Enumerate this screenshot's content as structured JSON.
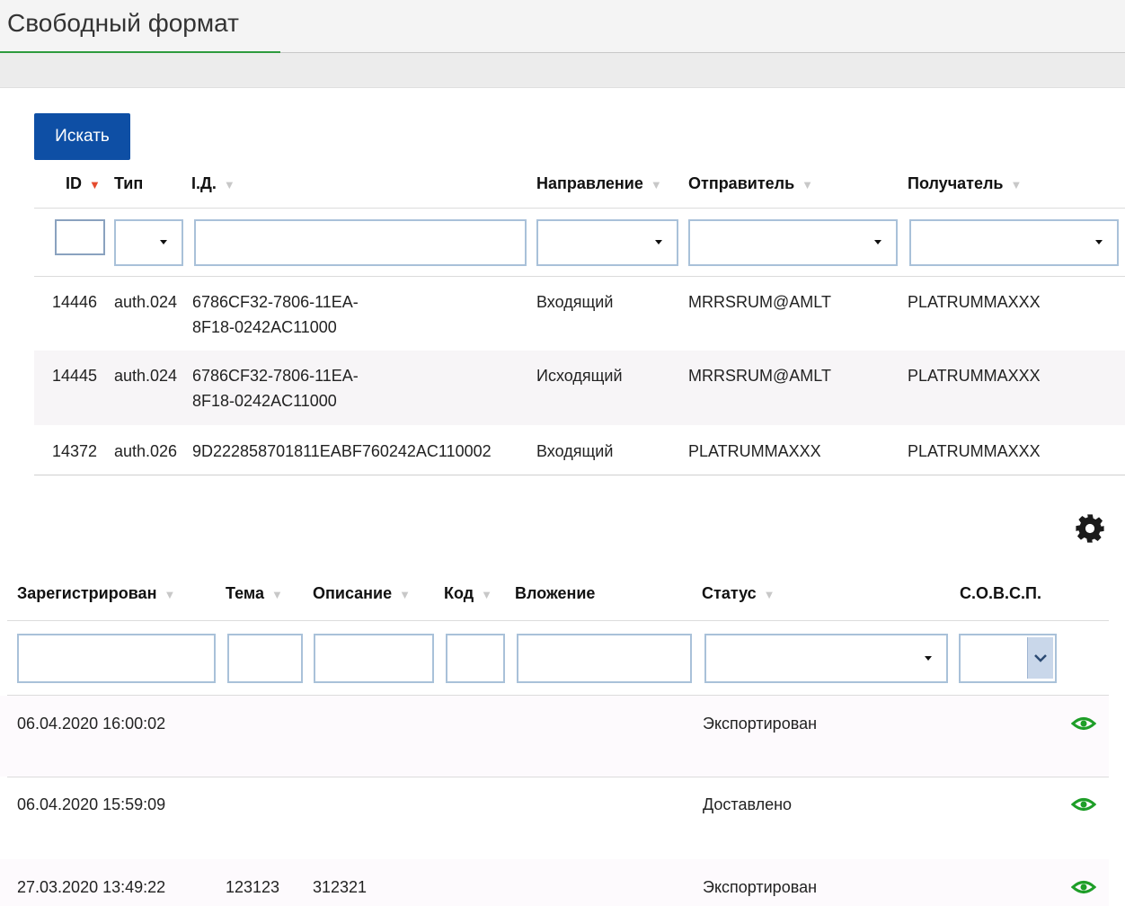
{
  "page": {
    "title": "Свободный формат"
  },
  "search_button": "Искать",
  "table1": {
    "columns": {
      "id": "ID",
      "type": "Тип",
      "ident": "I.Д.",
      "direction": "Направление",
      "sender": "Отправитель",
      "receiver": "Получатель"
    },
    "rows": [
      {
        "id": "14446",
        "type": "auth.024",
        "ident1": "6786CF32-7806-11EA-",
        "ident2": "8F18-0242AC11000",
        "direction": "Входящий",
        "sender": "MRRSRUM@AMLT",
        "receiver": "PLATRUMMAXXX"
      },
      {
        "id": "14445",
        "type": "auth.024",
        "ident1": "6786CF32-7806-11EA-",
        "ident2": "8F18-0242AC11000",
        "direction": "Исходящий",
        "sender": "MRRSRUM@AMLT",
        "receiver": "PLATRUMMAXXX"
      },
      {
        "id": "14372",
        "type": "auth.026",
        "ident1": "9D222858701811EABF760242AC110002",
        "ident2": "",
        "direction": "Входящий",
        "sender": "PLATRUMMAXXX",
        "receiver": "PLATRUMMAXXX"
      }
    ]
  },
  "table2": {
    "columns": {
      "registered": "Зарегистрирован",
      "subject": "Тема",
      "description": "Описание",
      "code": "Код",
      "attachment": "Вложение",
      "status": "Статус",
      "sovsp": "С.О.В.С.П."
    },
    "rows": [
      {
        "registered": "06.04.2020 16:00:02",
        "subject": "",
        "description": "",
        "status": "Экспортирован"
      },
      {
        "registered": "06.04.2020 15:59:09",
        "subject": "",
        "description": "",
        "status": "Доставлено"
      },
      {
        "registered": "27.03.2020 13:49:22",
        "subject": "123123",
        "description": "312321",
        "status": "Экспортирован"
      }
    ]
  },
  "icons": {
    "settings": "gear-icon",
    "view": "eye-icon"
  },
  "colors": {
    "accent_green": "#2e9b3e",
    "button_blue": "#0e4fa5",
    "sort_active": "#e54b2e",
    "eye_green": "#1e9e28"
  }
}
